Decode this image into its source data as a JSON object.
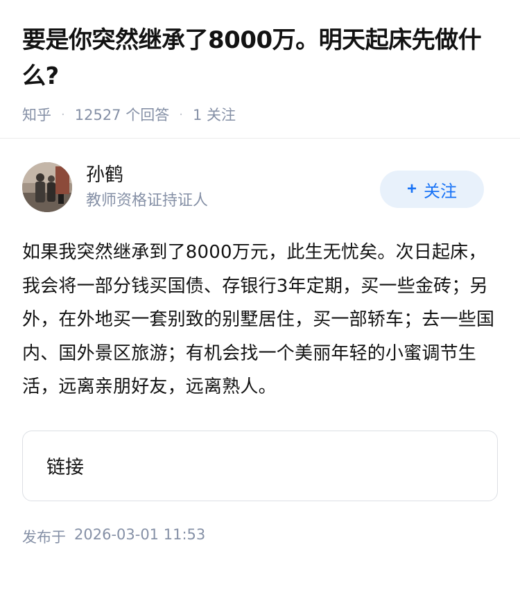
{
  "question": {
    "title": "要是你突然继承了8000万。明天起床先做什么?",
    "source": "知乎",
    "answer_count": "12527",
    "answer_count_label": "个回答",
    "follow_count": "1",
    "follow_label": "关注"
  },
  "answer": {
    "author_name": "孙鹤",
    "author_badge": "教师资格证持证人",
    "follow_button_label": "关注",
    "content": "如果我突然继承到了8000万元，此生无忧矣。次日起床，我会将一部分钱买国债、存银行3年定期，买一些金砖；另外，在外地买一套别致的别墅居住，买一部轿车；去一些国内、国外景区旅游；有机会找一个美丽年轻的小蜜调节生活，远离亲朋好友，远离熟人。",
    "link_card_label": "链接",
    "publish_prefix": "发布于",
    "publish_time": "2026-03-01 11:53"
  },
  "colors": {
    "accent": "#1772f6",
    "meta_text": "#8590a6",
    "follow_bg": "#e8f1fb"
  },
  "icons": {
    "follow": "plus-icon"
  }
}
